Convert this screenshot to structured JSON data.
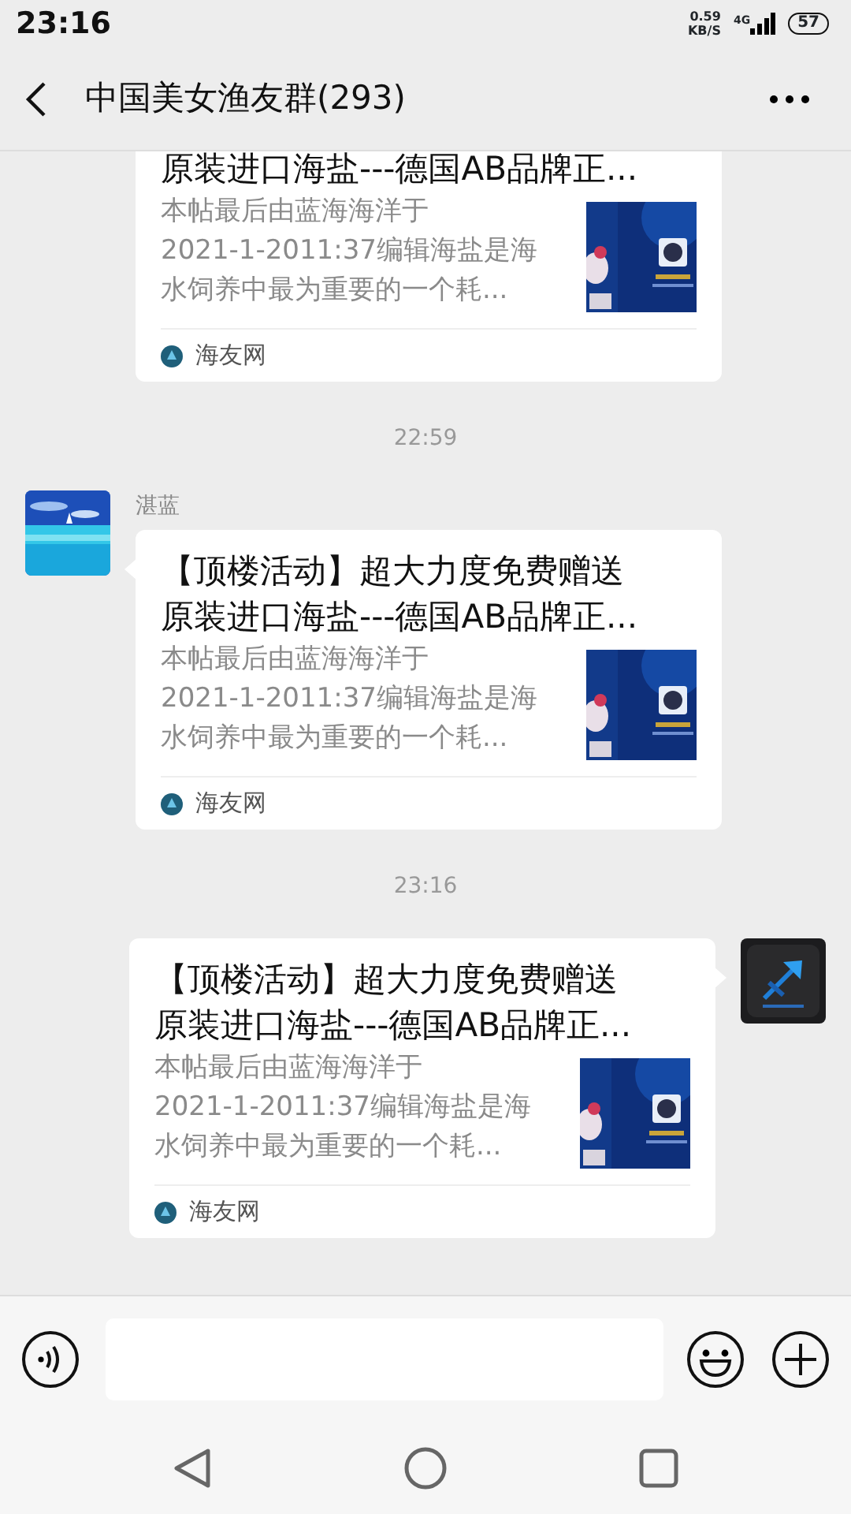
{
  "status_bar": {
    "time": "23:16",
    "speed": "0.59",
    "speed_unit": "KB/S",
    "network": "4G",
    "battery": "57"
  },
  "header": {
    "title": "中国美女渔友群(293)"
  },
  "messages": [
    {
      "kind": "incoming",
      "cut_top": true,
      "card": {
        "title": "原装进口海盐---德国AB品牌正...",
        "description_lines": [
          "本帖最后由蓝海海洋于",
          "2021-1-2011:37编辑海盐是海",
          "水饲养中最为重要的一个耗..."
        ],
        "source": "海友网"
      }
    },
    {
      "kind": "time",
      "text": "22:59"
    },
    {
      "kind": "incoming",
      "sender": "湛蓝",
      "card": {
        "title": "【顶楼活动】超大力度免费赠送原装进口海盐---德国AB品牌正...",
        "description_lines": [
          "本帖最后由蓝海海洋于",
          "2021-1-2011:37编辑海盐是海",
          "水饲养中最为重要的一个耗..."
        ],
        "source": "海友网"
      }
    },
    {
      "kind": "time",
      "text": "23:16"
    },
    {
      "kind": "outgoing",
      "card": {
        "title": "【顶楼活动】超大力度免费赠送原装进口海盐---德国AB品牌正...",
        "description_lines": [
          "本帖最后由蓝海海洋于",
          "2021-1-2011:37编辑海盐是海",
          "水饲养中最为重要的一个耗..."
        ],
        "source": "海友网"
      }
    }
  ]
}
